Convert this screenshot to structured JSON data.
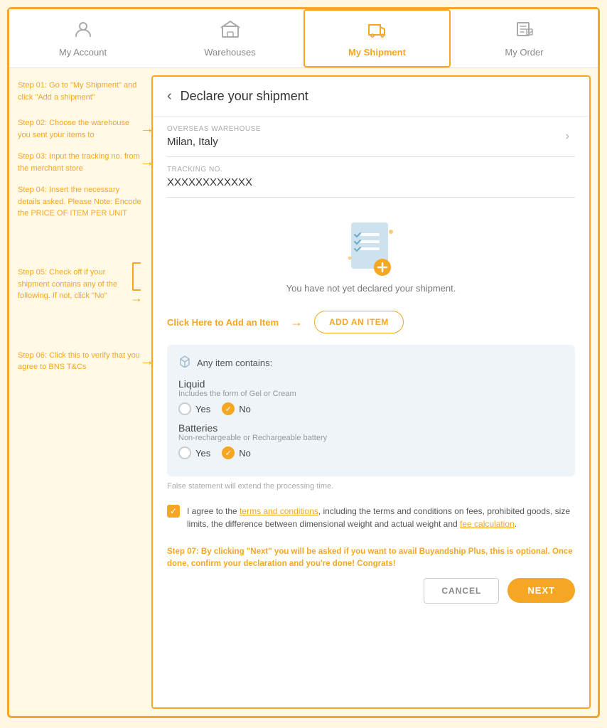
{
  "nav": {
    "items": [
      {
        "id": "my-account",
        "label": "My Account",
        "icon": "👤",
        "active": false
      },
      {
        "id": "warehouses",
        "label": "Warehouses",
        "icon": "🏭",
        "active": false
      },
      {
        "id": "my-shipment",
        "label": "My Shipment",
        "icon": "📦",
        "active": true
      },
      {
        "id": "my-order",
        "label": "My Order",
        "icon": "🛒",
        "active": false
      }
    ]
  },
  "sidebar": {
    "step01": "Step 01: Go to \"My Shipment\" and click \"Add a shipment\"",
    "step02": "Step 02: Choose the warehouse you sent your items to",
    "step03": "Step 03: Input the tracking no. from the merchant store",
    "step04": "Step 04: Insert the necessary details asked. Please Note: Encode the PRICE OF ITEM PER UNIT",
    "step05": "Step 05: Check off if your shipment contains any of the following. If not, click \"No\"",
    "step06": "Step 06: Click this to verify that you agree to BNS T&Cs"
  },
  "form": {
    "title": "Declare your shipment",
    "warehouse_label": "OVERSEAS WAREHOUSE",
    "warehouse_value": "Milan, Italy",
    "tracking_label": "TRACKING NO.",
    "tracking_value": "XXXXXXXXXXXX",
    "empty_state_text": "You have not yet declared your shipment.",
    "add_item_label": "Click Here to Add an Item",
    "add_item_btn": "ADD AN ITEM",
    "contains_title": "Any item contains:",
    "liquid_label": "Liquid",
    "liquid_sub": "Includes the form of Gel or Cream",
    "liquid_yes": "Yes",
    "liquid_no": "No",
    "batteries_label": "Batteries",
    "batteries_sub": "Non-rechargeable or Rechargeable battery",
    "batteries_yes": "Yes",
    "batteries_no": "No",
    "false_statement": "False statement will extend the processing time.",
    "agreement_text1": "I agree to the ",
    "agreement_link1": "terms and conditions",
    "agreement_text2": ", including the terms and conditions on fees, prohibited goods, size limits, the difference between dimensional weight and actual weight and ",
    "agreement_link2": "fee calculation",
    "agreement_text3": ".",
    "step07": "Step 07: By clicking \"Next\" you will be asked if you want to avail Buyandship Plus, this is optional. Once done, confirm your declaration and you're done! Congrats!",
    "cancel_label": "CANCEL",
    "next_label": "NEXT"
  }
}
